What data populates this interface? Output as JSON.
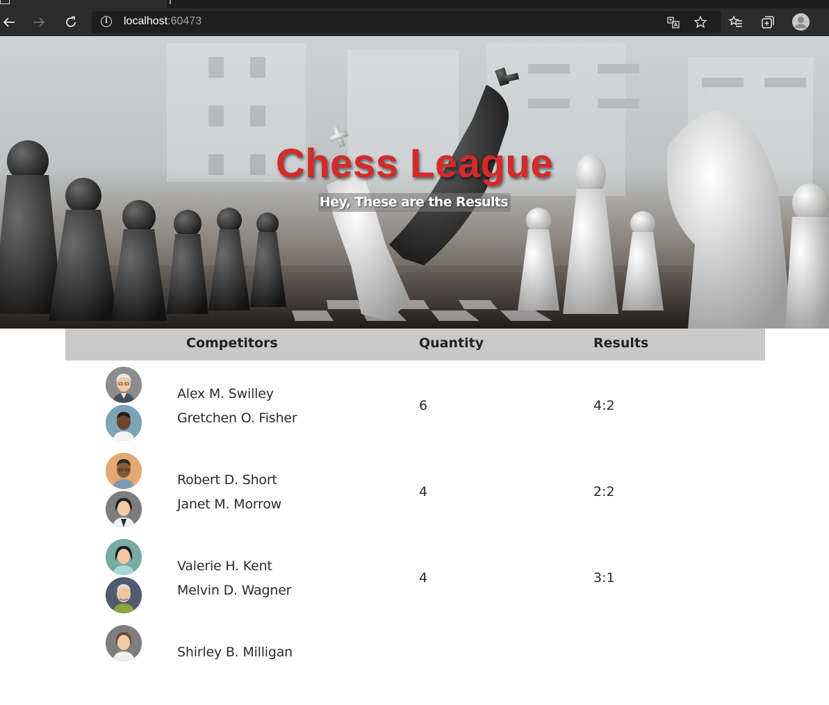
{
  "browser": {
    "url_host": "localhost",
    "url_port": ":60473",
    "icons": [
      "back-icon",
      "forward-icon",
      "refresh-icon",
      "info-icon",
      "translate-icon",
      "favorite-star-icon",
      "favorites-list-icon",
      "collections-icon",
      "profile-avatar-icon"
    ]
  },
  "hero": {
    "title": "Chess League",
    "subtitle": "Hey, These are the Results",
    "title_color": "#d42a2a"
  },
  "table": {
    "headers": {
      "competitors": "Competitors",
      "quantity": "Quantity",
      "results": "Results"
    },
    "header_bg": "#c9c9c9",
    "rows": [
      {
        "player1": "Alex M. Swilley",
        "player2": "Gretchen O. Fisher",
        "quantity": "6",
        "result": "4:2"
      },
      {
        "player1": "Robert D. Short",
        "player2": "Janet M. Morrow",
        "quantity": "4",
        "result": "2:2"
      },
      {
        "player1": "Valerie H. Kent",
        "player2": "Melvin D. Wagner",
        "quantity": "4",
        "result": "3:1"
      },
      {
        "player1": "Shirley B. Milligan",
        "player2": "",
        "quantity": "",
        "result": ""
      }
    ]
  }
}
